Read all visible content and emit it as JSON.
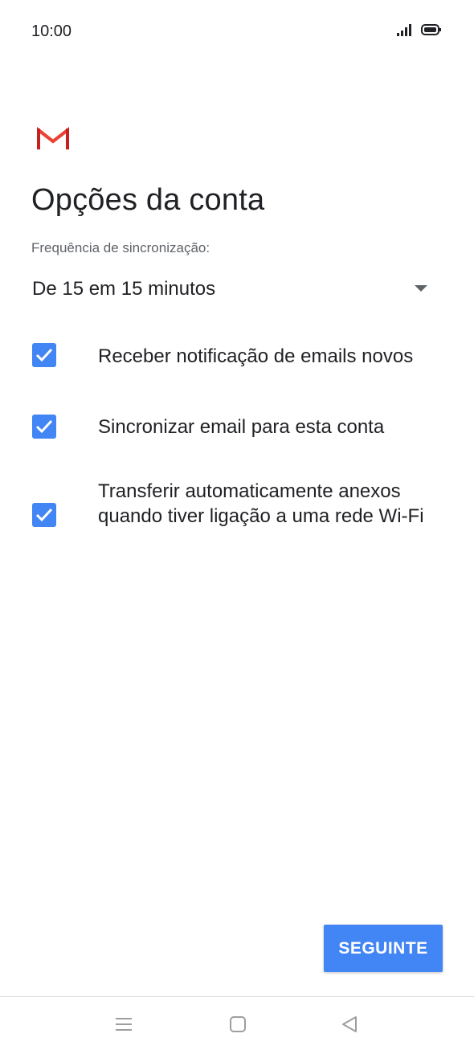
{
  "status_bar": {
    "time": "10:00",
    "icons": [
      "signal-icon",
      "battery-icon"
    ]
  },
  "app": {
    "logo_icon": "gmail-logo-icon",
    "colors": {
      "accent": "#4285f4",
      "gmail_red": "#d93025"
    }
  },
  "page": {
    "title": "Opções da conta"
  },
  "sync": {
    "label": "Frequência de sincronização:",
    "selected_value": "De 15 em 15 minutos"
  },
  "options": [
    {
      "label": "Receber notificação de emails novos",
      "checked": true
    },
    {
      "label": "Sincronizar email para esta conta",
      "checked": true
    },
    {
      "label": "Transferir automaticamente anexos quando tiver ligação a uma rede Wi-Fi",
      "checked": true
    }
  ],
  "actions": {
    "next_label": "SEGUINTE"
  },
  "navigation": {
    "buttons": [
      "menu-icon",
      "home-icon",
      "back-icon"
    ]
  }
}
